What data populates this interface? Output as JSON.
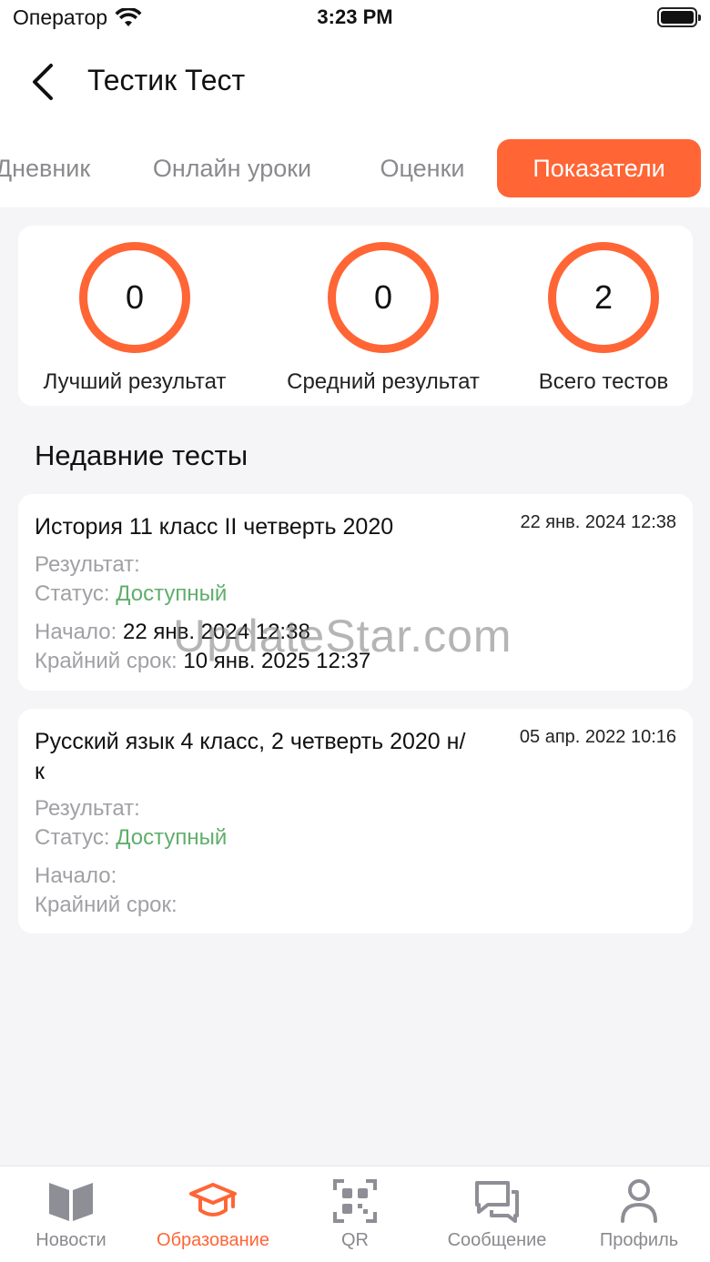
{
  "status_bar": {
    "carrier": "Оператор",
    "time": "3:23 PM"
  },
  "header": {
    "title": "Тестик Тест"
  },
  "tabs": [
    {
      "label": "Дневник"
    },
    {
      "label": "Онлайн уроки"
    },
    {
      "label": "Оценки"
    },
    {
      "label": "Показатели"
    }
  ],
  "stats": [
    {
      "value": "0",
      "label": "Лучший результат"
    },
    {
      "value": "0",
      "label": "Средний результат"
    },
    {
      "value": "2",
      "label": "Всего тестов"
    }
  ],
  "section_title": "Недавние тесты",
  "labels": {
    "result": "Результат:",
    "status": "Статус:",
    "start": "Начало:",
    "deadline": "Крайний срок:"
  },
  "tests": [
    {
      "title": "История 11 класс II четверть 2020",
      "date": "22 янв. 2024 12:38",
      "result": "",
      "status": "Доступный",
      "start": "22 янв. 2024 12:38",
      "deadline": "10 янв. 2025 12:37"
    },
    {
      "title": "Русский язык 4 класс, 2 четверть 2020 н/к",
      "date": "05 апр. 2022 10:16",
      "result": "",
      "status": "Доступный",
      "start": "",
      "deadline": ""
    }
  ],
  "watermark": "UpdateStar.com",
  "bottom_nav": [
    {
      "label": "Новости",
      "icon": "book-icon"
    },
    {
      "label": "Образование",
      "icon": "graduation-cap-icon"
    },
    {
      "label": "QR",
      "icon": "qr-code-icon"
    },
    {
      "label": "Сообщение",
      "icon": "chat-icon"
    },
    {
      "label": "Профиль",
      "icon": "person-icon"
    }
  ],
  "colors": {
    "accent": "#ff6535",
    "status_available": "#5fae6b",
    "muted": "#a0a0a5"
  }
}
